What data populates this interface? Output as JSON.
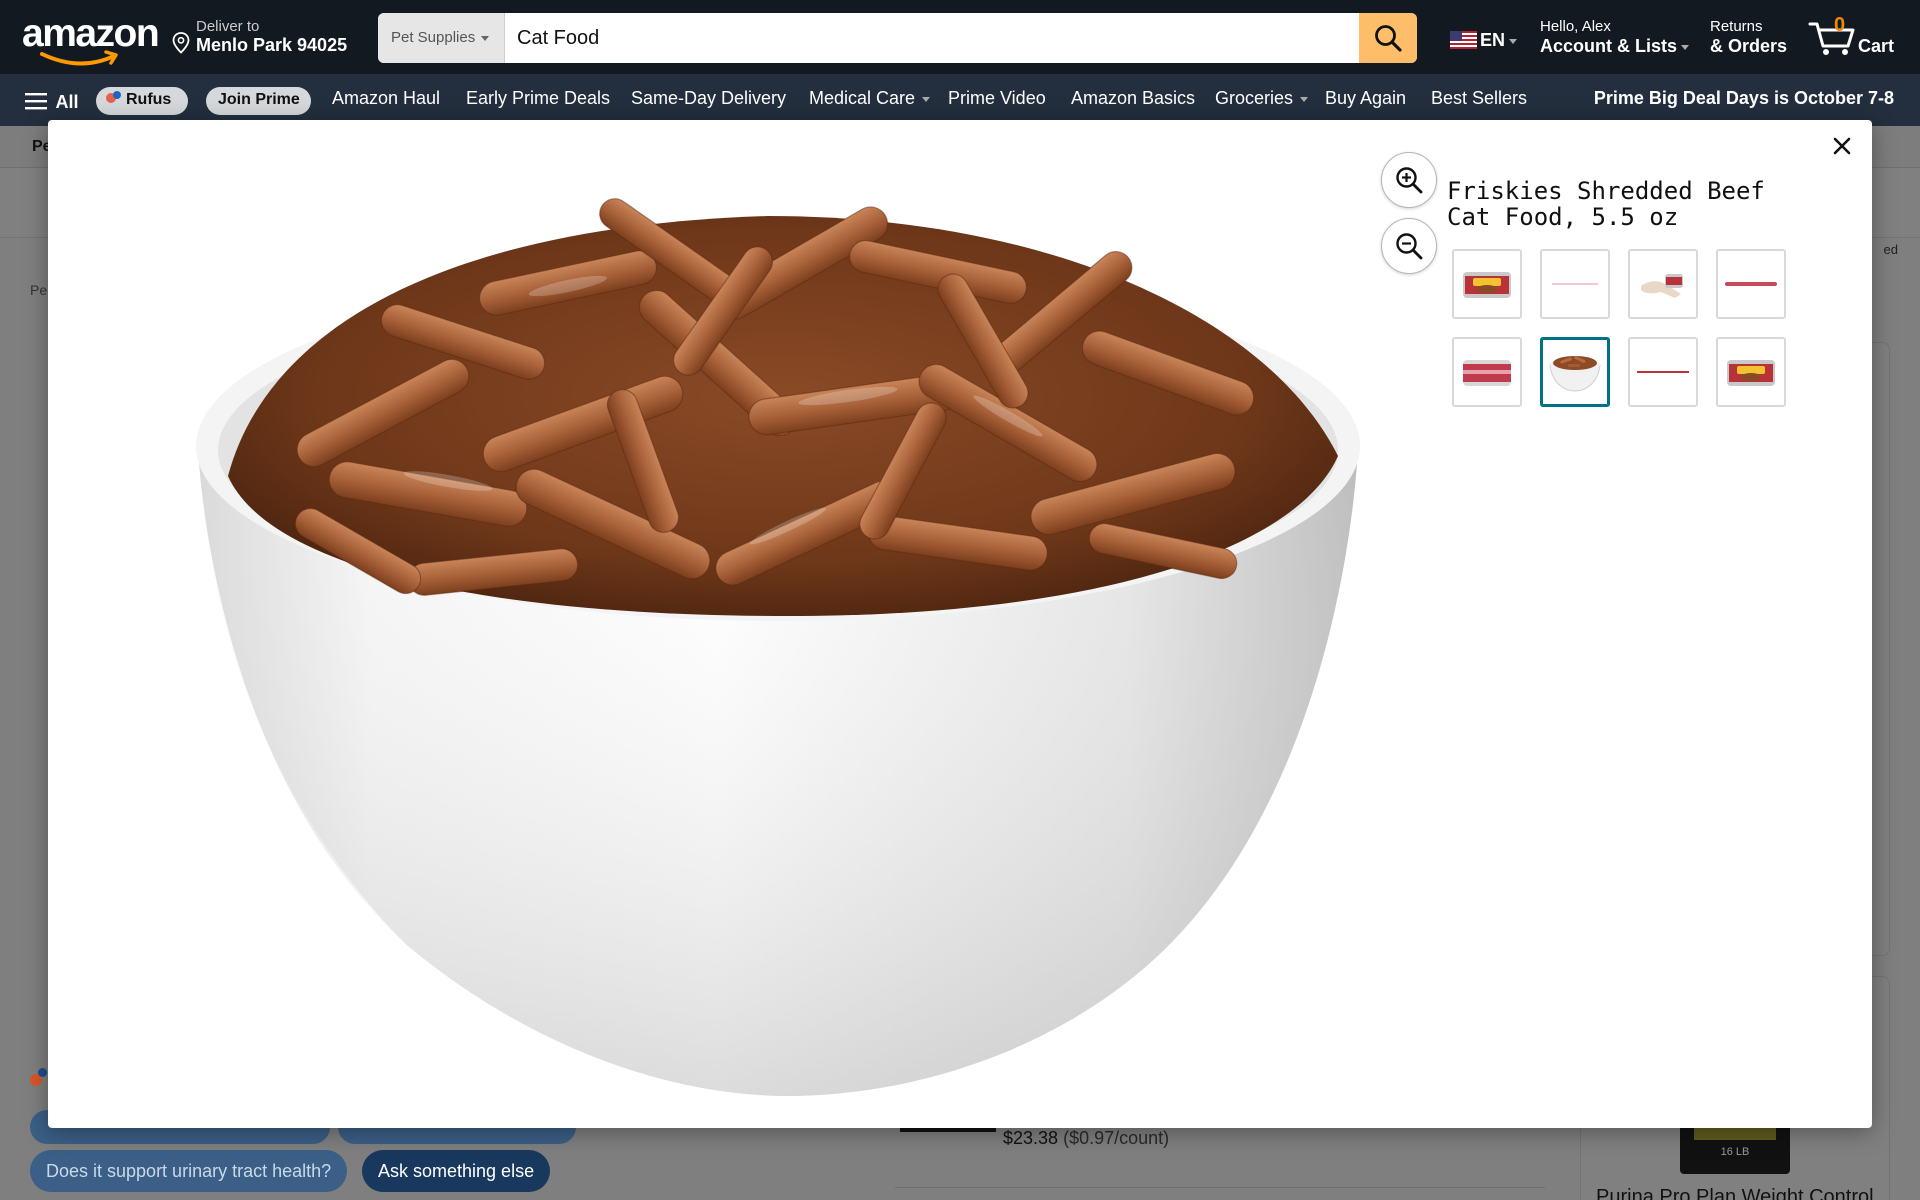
{
  "header": {
    "logo_text": "amazon",
    "deliver_label": "Deliver to",
    "deliver_location": "Menlo Park 94025",
    "search_category": "Pet Supplies",
    "search_value": "Cat Food",
    "language": "EN",
    "greeting": "Hello, Alex",
    "account_label": "Account & Lists",
    "returns_label": "Returns",
    "orders_label": "& Orders",
    "cart_count": "0",
    "cart_label": "Cart"
  },
  "nav": {
    "all_label": "All",
    "rufus_label": "Rufus",
    "join_prime_label": "Join Prime",
    "items": [
      "Amazon Haul",
      "Early Prime Deals",
      "Same-Day Delivery",
      "Medical Care",
      "Prime Video",
      "Amazon Basics",
      "Groceries",
      "Buy Again",
      "Best Sellers"
    ],
    "promo": "Prime Big Deal Days is October 7-8"
  },
  "underlying": {
    "subnav_partial": "Pe",
    "breadcrumb_partial": "Pe",
    "sponsored_partial": "ed",
    "price": "$23.38",
    "unit_price": "($0.97/count)",
    "rufus_questions": [
      "Does it support urinary tract health?",
      "Ask something else"
    ],
    "sidebar_product": "Purina Pro Plan Weight Control",
    "bag_label": "16 LB"
  },
  "modal": {
    "title": "Friskies Shredded Beef Cat Food, 5.5 oz",
    "selected_thumb_index": 5,
    "thumbnails": [
      "can-front",
      "blank-white",
      "hand-holding-can",
      "can-side-line",
      "can-side",
      "bowl-of-food",
      "can-top-line",
      "can-front-alt"
    ]
  },
  "colors": {
    "header_bg": "#131921",
    "subnav_bg": "#232f3e",
    "search_button": "#febd69",
    "cart_count": "#f08804",
    "selected_thumb_border": "#007185",
    "rufus_button_dark": "#18385e"
  }
}
